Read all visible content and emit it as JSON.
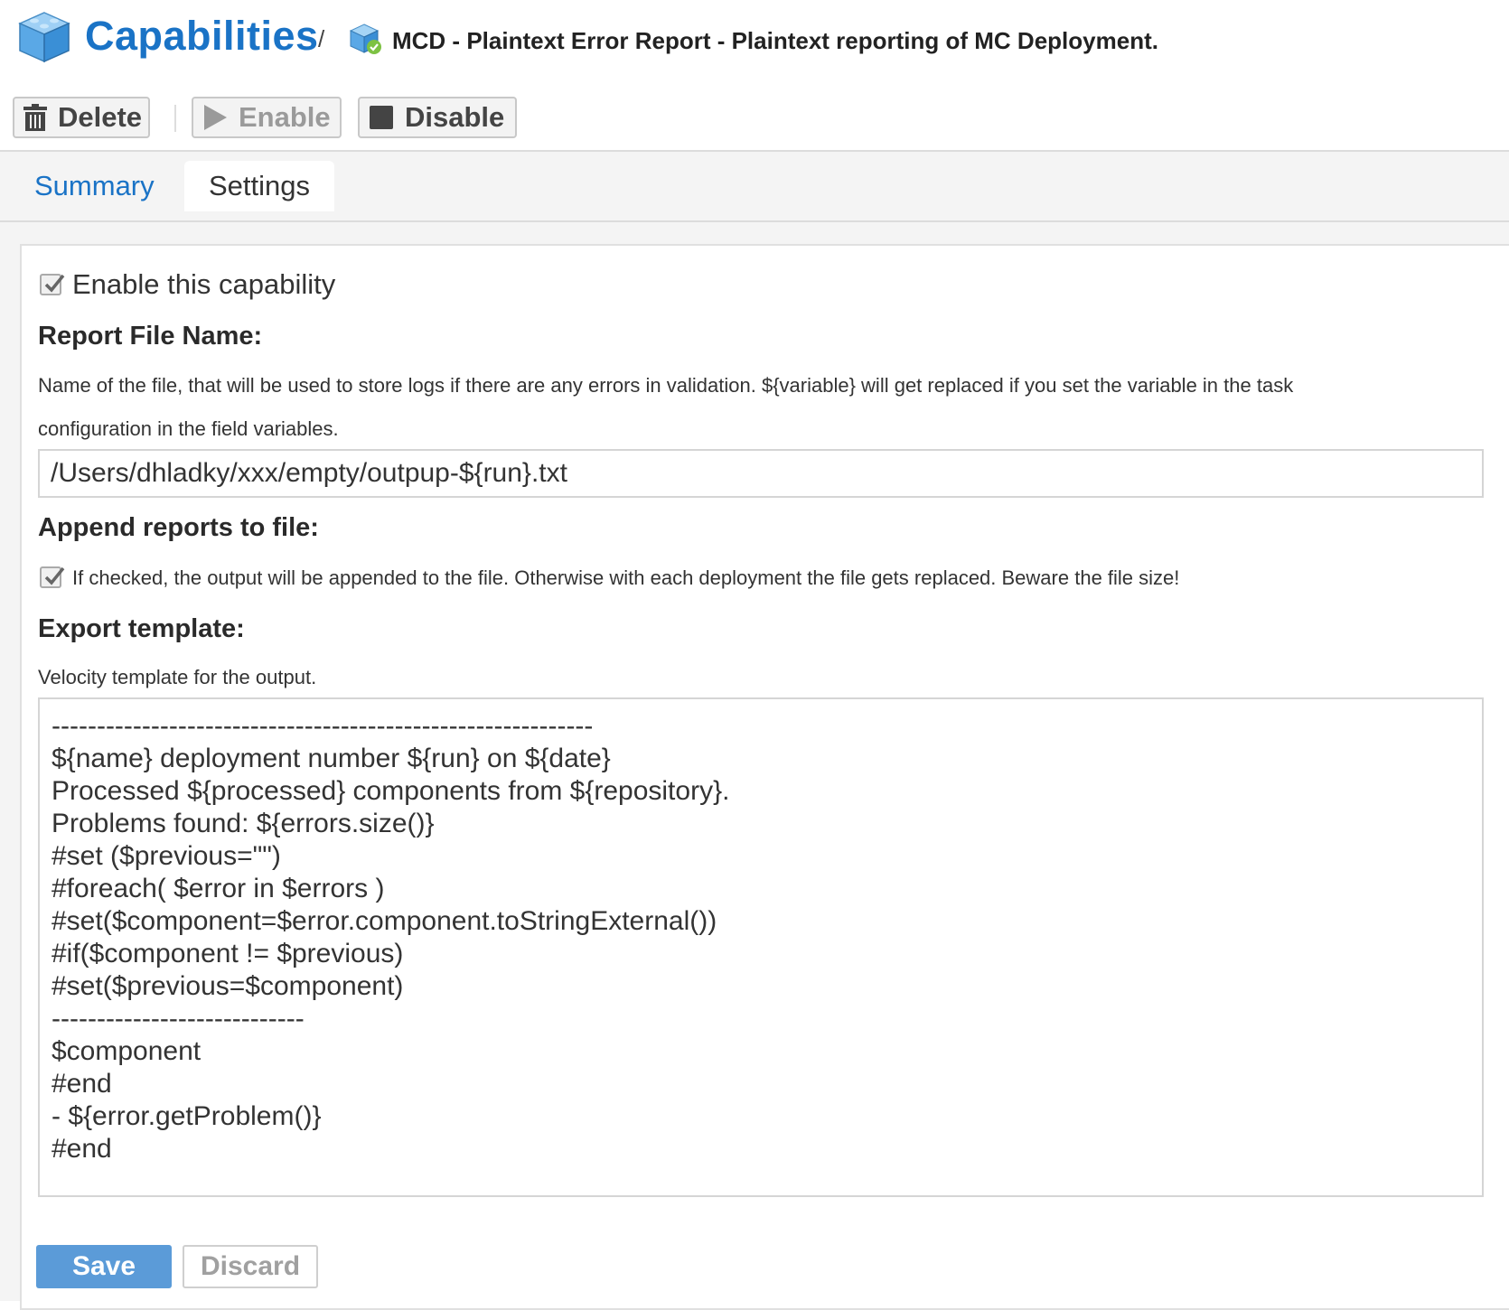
{
  "header": {
    "title": "Capabilities",
    "separator": "/",
    "item_title": "MCD - Plaintext Error Report - Plaintext reporting of MC Deployment.",
    "title_icon": "cube-icon",
    "item_icon": "cube-check-icon"
  },
  "toolbar": {
    "delete_label": "Delete",
    "enable_label": "Enable",
    "disable_label": "Disable"
  },
  "tabs": {
    "summary_label": "Summary",
    "settings_label": "Settings"
  },
  "settings": {
    "enable_label": "Enable this capability",
    "enable_checked": true,
    "report_file": {
      "title": "Report File Name:",
      "description_line1": "Name of the file, that will be used to store logs if there are any errors in validation. ${variable} will get replaced if you set the variable in the task",
      "description_line2": "configuration in the field variables.",
      "value": "/Users/dhladky/xxx/empty/outpup-${run}.txt"
    },
    "append": {
      "title": "Append reports to file:",
      "label": "If checked, the output will be appended to the file. Otherwise with each deployment the file gets replaced. Beware the file size!",
      "checked": true
    },
    "export_template": {
      "title": "Export template:",
      "description": "Velocity template for the output.",
      "value": "------------------------------------------------------------\n${name} deployment number ${run} on ${date}\nProcessed ${processed} components from ${repository}.\nProblems found: ${errors.size()}\n#set ($previous=\"\")\n#foreach( $error in $errors )\n#set($component=$error.component.toStringExternal())\n#if($component != $previous)\n#set($previous=$component)\n----------------------------\n$component\n#end\n- ${error.getProblem()}\n#end"
    }
  },
  "actions": {
    "save_label": "Save",
    "discard_label": "Discard"
  },
  "colors": {
    "accent": "#1a73c6",
    "save_bg": "#5b9bd8"
  }
}
